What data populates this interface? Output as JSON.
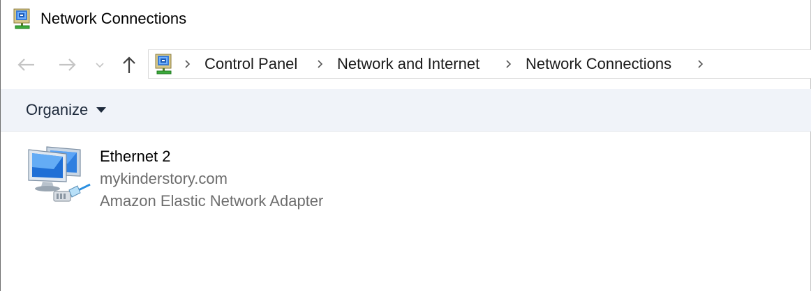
{
  "window": {
    "title": "Network Connections",
    "icon": "network-connections-icon"
  },
  "navigation": {
    "back_icon": "arrow-left-icon",
    "forward_icon": "arrow-right-icon",
    "recent_icon": "chevron-down-icon",
    "up_icon": "arrow-up-icon"
  },
  "address_bar": {
    "icon": "network-connections-icon",
    "breadcrumbs": [
      "Control Panel",
      "Network and Internet",
      "Network Connections"
    ]
  },
  "command_bar": {
    "organize_label": "Organize"
  },
  "connections": [
    {
      "name": "Ethernet 2",
      "network": "mykinderstory.com",
      "adapter": "Amazon Elastic Network Adapter",
      "icon": "ethernet-adapter-icon"
    }
  ]
}
